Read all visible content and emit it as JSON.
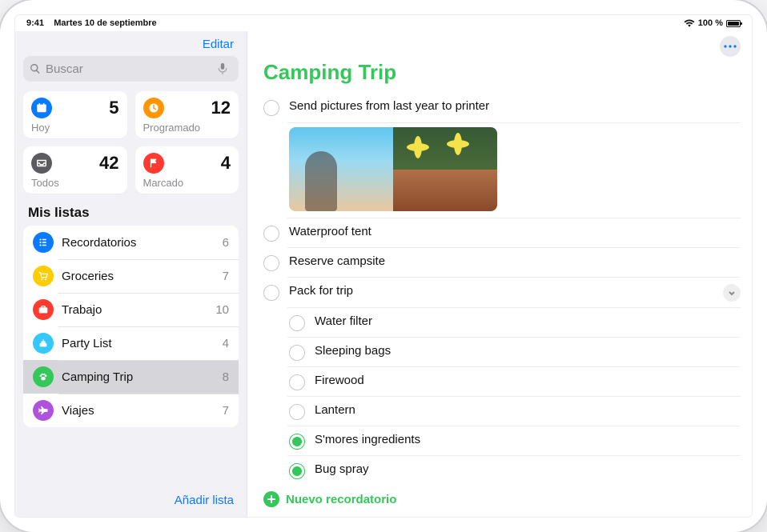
{
  "statusbar": {
    "time": "9:41",
    "date": "Martes 10 de septiembre",
    "battery": "100 %"
  },
  "sidebar": {
    "edit": "Editar",
    "search_placeholder": "Buscar",
    "smart": [
      {
        "label": "Hoy",
        "count": "5",
        "color": "blue",
        "icon": "calendar"
      },
      {
        "label": "Programado",
        "count": "12",
        "color": "orange",
        "icon": "clock"
      },
      {
        "label": "Todos",
        "count": "42",
        "color": "grey",
        "icon": "inbox"
      },
      {
        "label": "Marcado",
        "count": "4",
        "color": "red",
        "icon": "flag"
      }
    ],
    "lists_header": "Mis listas",
    "lists": [
      {
        "name": "Recordatorios",
        "count": "6",
        "color": "blue",
        "icon": "list",
        "selected": false
      },
      {
        "name": "Groceries",
        "count": "7",
        "color": "yellow",
        "icon": "cart",
        "selected": false
      },
      {
        "name": "Trabajo",
        "count": "10",
        "color": "red",
        "icon": "briefcase",
        "selected": false
      },
      {
        "name": "Party List",
        "count": "4",
        "color": "lblue",
        "icon": "cake",
        "selected": false
      },
      {
        "name": "Camping Trip",
        "count": "8",
        "color": "green",
        "icon": "paw",
        "selected": true
      },
      {
        "name": "Viajes",
        "count": "7",
        "color": "purple",
        "icon": "plane",
        "selected": false
      }
    ],
    "add_list": "Añadir lista"
  },
  "main": {
    "title": "Camping Trip",
    "new_reminder": "Nuevo recordatorio",
    "items": [
      {
        "text": "Send pictures from last year to printer",
        "checked": false,
        "has_images": true
      },
      {
        "text": "Waterproof tent",
        "checked": false
      },
      {
        "text": "Reserve campsite",
        "checked": false
      },
      {
        "text": "Pack for trip",
        "checked": false,
        "expandable": true,
        "subitems": [
          {
            "text": "Water filter",
            "checked": false
          },
          {
            "text": "Sleeping bags",
            "checked": false
          },
          {
            "text": "Firewood",
            "checked": false
          },
          {
            "text": "Lantern",
            "checked": false
          },
          {
            "text": "S'mores ingredients",
            "checked": true
          },
          {
            "text": "Bug spray",
            "checked": true
          }
        ]
      }
    ]
  }
}
